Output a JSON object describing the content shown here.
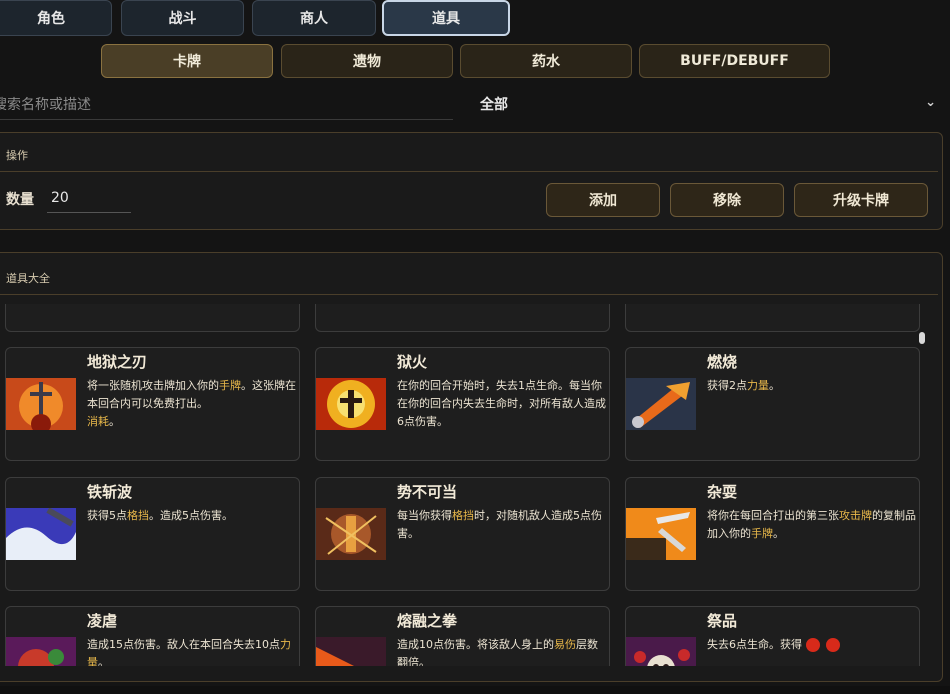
{
  "top_tabs": [
    {
      "label": "角色"
    },
    {
      "label": "战斗"
    },
    {
      "label": "商人"
    },
    {
      "label": "道具"
    }
  ],
  "sub_tabs": [
    {
      "label": "卡牌"
    },
    {
      "label": "遗物"
    },
    {
      "label": "药水"
    },
    {
      "label": "BUFF/DEBUFF"
    }
  ],
  "search": {
    "placeholder": "搜索名称或描述"
  },
  "filter": {
    "value": "全部"
  },
  "operations": {
    "title": "操作",
    "quantity_label": "数量",
    "quantity_value": "20",
    "add_label": "添加",
    "remove_label": "移除",
    "upgrade_label": "升级卡牌"
  },
  "catalog": {
    "title": "道具大全",
    "cards": [
      {
        "name": "地狱之刃",
        "desc": [
          "将一张随机攻击牌加入你的",
          "手牌",
          "。这张牌在本回合内可以免费打出。",
          "消耗",
          "。"
        ]
      },
      {
        "name": "狱火",
        "desc": [
          "在你的回合开始时，失去1点生命。每当你在你的回合内失去生命时，对所有敌人造成6点伤害。"
        ]
      },
      {
        "name": "燃烧",
        "desc": [
          "获得2点",
          "力量",
          "。"
        ]
      },
      {
        "name": "铁斩波",
        "desc": [
          "获得5点",
          "格挡",
          "。造成5点伤害。"
        ]
      },
      {
        "name": "势不可当",
        "desc": [
          "每当你获得",
          "格挡",
          "时，对随机敌人造成5点伤害。"
        ]
      },
      {
        "name": "杂耍",
        "desc": [
          "将你在每回合打出的第三张",
          "攻击牌",
          "的复制品加入你的",
          "手牌",
          "。"
        ]
      },
      {
        "name": "凌虐",
        "desc": [
          "造成15点伤害。敌人在本回合失去10点",
          "力量",
          "。"
        ]
      },
      {
        "name": "熔融之拳",
        "desc": [
          "造成10点伤害。将该敌人身上的",
          "易伤",
          "层数翻倍。"
        ]
      },
      {
        "name": "祭品",
        "desc": [
          "失去6点生命。获得"
        ]
      }
    ]
  },
  "colors": {
    "highlight": "#e8b84a",
    "accent_gold": "#8a7240"
  }
}
